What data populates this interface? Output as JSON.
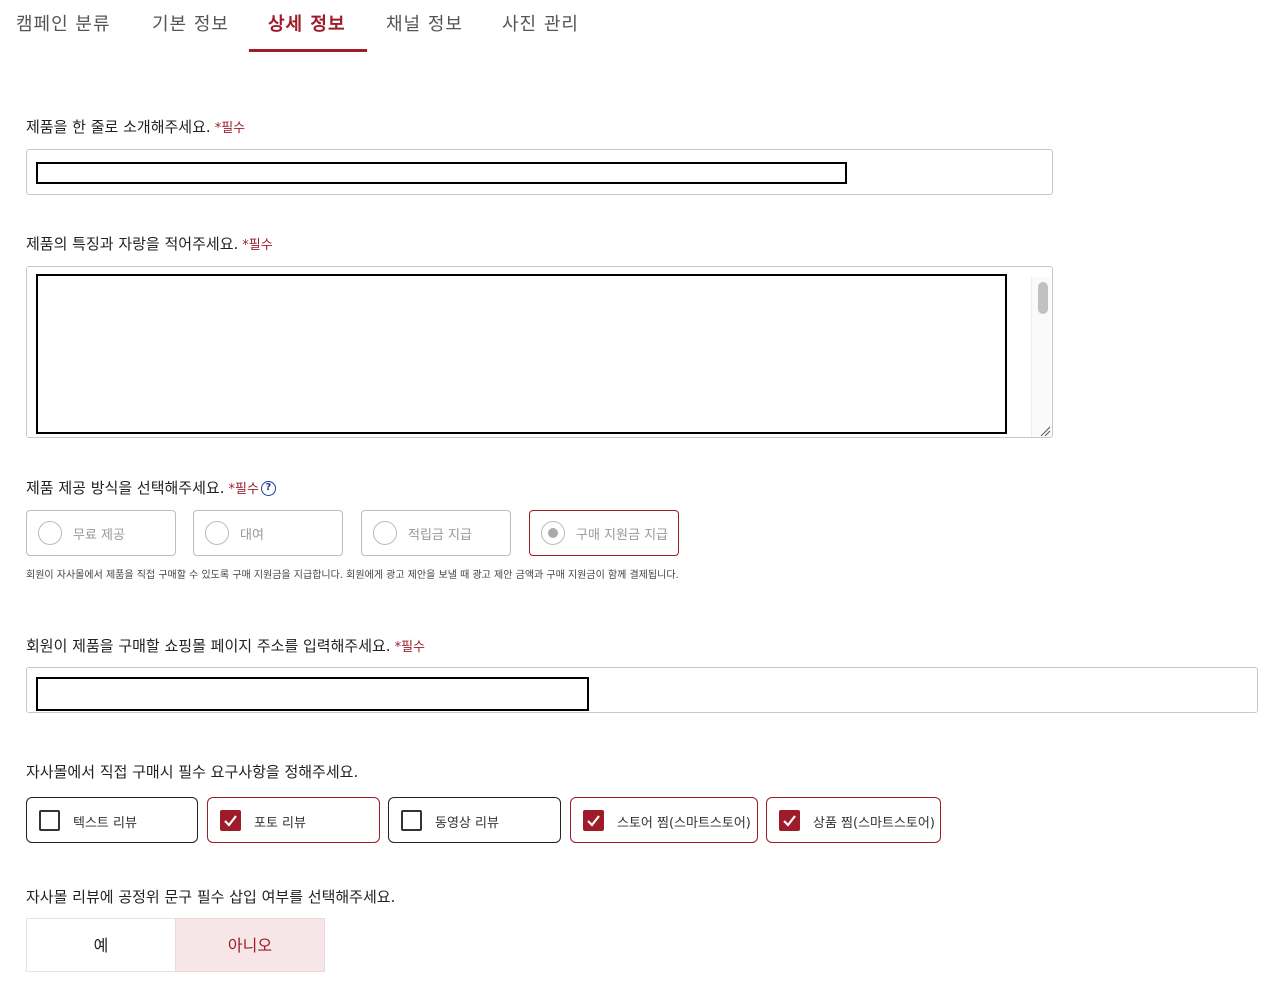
{
  "tabs": [
    {
      "label": "캠페인 분류"
    },
    {
      "label": "기본 정보"
    },
    {
      "label": "상세 정보"
    },
    {
      "label": "채널 정보"
    },
    {
      "label": "사진 관리"
    }
  ],
  "active_tab": "상세 정보",
  "required_mark": "*필수",
  "oneliner": {
    "label": "제품을 한 줄로 소개해주세요.",
    "value": ""
  },
  "features": {
    "label": "제품의 특징과 자랑을 적어주세요.",
    "value": ""
  },
  "provide_method": {
    "label": "제품 제공 방식을 선택해주세요.",
    "options": [
      {
        "label": "무료 제공",
        "selected": false
      },
      {
        "label": "대여",
        "selected": false
      },
      {
        "label": "적립금 지급",
        "selected": false
      },
      {
        "label": "구매 지원금 지급",
        "selected": true
      }
    ],
    "note": "회원이 자사몰에서 제품을 직접 구매할 수 있도록 구매 지원금을 지급합니다. 회원에게 광고 제안을 보낼 때 광고 제안 금액과 구매 지원금이 함께 결제됩니다."
  },
  "shop_url": {
    "label": "회원이 제품을 구매할 쇼핑몰 페이지 주소를 입력해주세요.",
    "value": ""
  },
  "requirements": {
    "label": "자사몰에서 직접 구매시 필수 요구사항을 정해주세요.",
    "options": [
      {
        "label": "텍스트 리뷰",
        "checked": false
      },
      {
        "label": "포토 리뷰",
        "checked": true
      },
      {
        "label": "동영상 리뷰",
        "checked": false
      },
      {
        "label": "스토어 찜(스마트스토어)",
        "checked": true
      },
      {
        "label": "상품 찜(스마트스토어)",
        "checked": true
      }
    ]
  },
  "ftc_phrase": {
    "label": "자사몰 리뷰에 공정위 문구 필수 삽입 여부를 선택해주세요.",
    "yes": "예",
    "no": "아니오",
    "selected": "아니오"
  },
  "colors": {
    "accent": "#9e1b2a",
    "selected_bg": "#f7e6e8",
    "help_icon": "#1f3d99"
  },
  "icons": {
    "help": "question-circle-icon",
    "check": "checkmark-icon",
    "resize": "resize-grip-icon"
  }
}
